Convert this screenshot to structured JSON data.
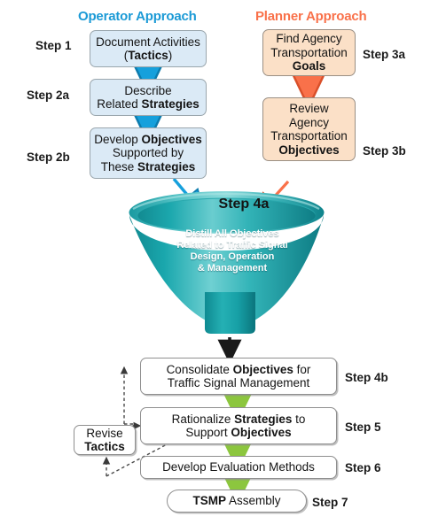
{
  "headings": {
    "operator": "Operator Approach",
    "planner": "Planner Approach",
    "operator_color": "#1b9ad6",
    "planner_color": "#f9714a"
  },
  "steps": {
    "s1": "Step 1",
    "s2a": "Step 2a",
    "s2b": "Step 2b",
    "s3a": "Step 3a",
    "s3b": "Step 3b",
    "s4a": "Step 4a",
    "s4b": "Step 4b",
    "s5": "Step 5",
    "s6": "Step 6",
    "s7": "Step 7"
  },
  "boxes": {
    "document_activities": {
      "line1": "Document Activities",
      "line2_bold": "Tactics",
      "line2_pre": "(",
      "line2_post": ")"
    },
    "describe_strategies": {
      "line1": "Describe",
      "line2_pre": "Related ",
      "line2_bold": "Strategies"
    },
    "develop_objectives": {
      "line1_pre": "Develop ",
      "line1_bold": "Objectives",
      "line2": "Supported by",
      "line3_pre": "These ",
      "line3_bold": "Strategies"
    },
    "find_goals": {
      "line1": "Find Agency",
      "line2": "Transportation",
      "line3_bold": "Goals"
    },
    "review_objectives": {
      "line1": "Review",
      "line2": "Agency",
      "line3": "Transportation",
      "line4_bold": "Objectives"
    },
    "funnel": {
      "l1_pre": "Distill All ",
      "l1_bold": "Objectives",
      "l2": "Related to Traffic Signal",
      "l3": "Design, Operation",
      "l4": "& Management",
      "fill_color": "#169aa0"
    },
    "consolidate": {
      "line1_pre": "Consolidate ",
      "line1_bold": "Objectives",
      "line1_post": " for",
      "line2": "Traffic Signal Management"
    },
    "rationalize": {
      "line1_pre": "Rationalize ",
      "line1_bold": "Strategies",
      "line1_post": " to",
      "line2_pre": "Support ",
      "line2_bold": "Objectives"
    },
    "develop_evaluation": {
      "line1": "Develop Evaluation Methods"
    },
    "tsmp": {
      "bold": "TSMP",
      "post": " Assembly"
    },
    "revise_tactics": {
      "line1": "Revise",
      "line2_bold": "Tactics"
    }
  },
  "colors": {
    "blue_box_fill": "#dbeaf6",
    "orange_box_fill": "#fbe0c7",
    "blue_arrow": "#16a0dc",
    "orange_arrow": "#f9714a",
    "green_arrow": "#8cc63e",
    "black_arrow": "#1a1a1a",
    "dashed_line": "#4d4d4d",
    "funnel_teal": "#169aa0"
  }
}
